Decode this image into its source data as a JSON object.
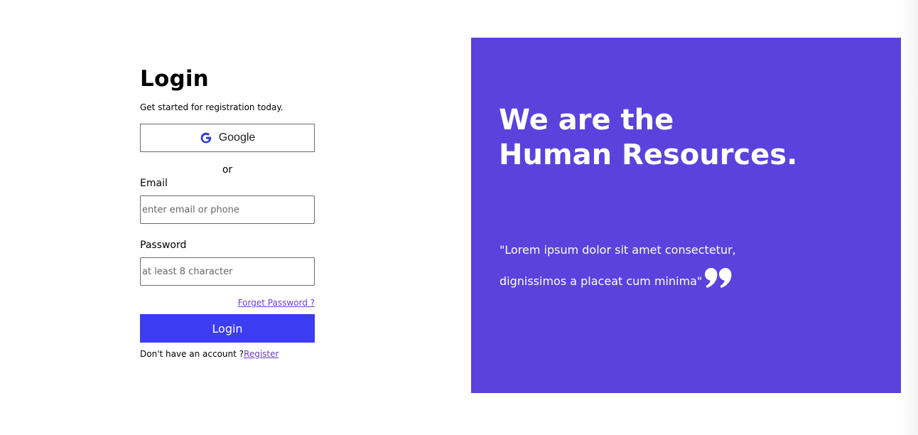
{
  "login": {
    "title": "Login",
    "subtitle": "Get started for registration today.",
    "google_label": "Google",
    "or_text": "or",
    "email_label": "Email",
    "email_placeholder": "enter email or phone",
    "password_label": "Password",
    "password_placeholder": "at least 8 character",
    "forgot_label": "Forget Password ?",
    "submit_label": "Login",
    "no_account_text": "Don't have an account ?",
    "register_label": "Register"
  },
  "hero": {
    "title_line1": "We are the",
    "title_line2": "Human Resources.",
    "quote_line1": "\"Lorem ipsum dolor sit amet consectetur,",
    "quote_line2": "dignissimos a placeat cum minima\""
  },
  "colors": {
    "accent": "#3c3cf2",
    "hero_bg": "#5c42dc",
    "link": "#6a3dcc",
    "google_icon": "#2f3ad9"
  },
  "icons": {
    "google": "google-icon",
    "quote": "quote-mark-icon"
  }
}
